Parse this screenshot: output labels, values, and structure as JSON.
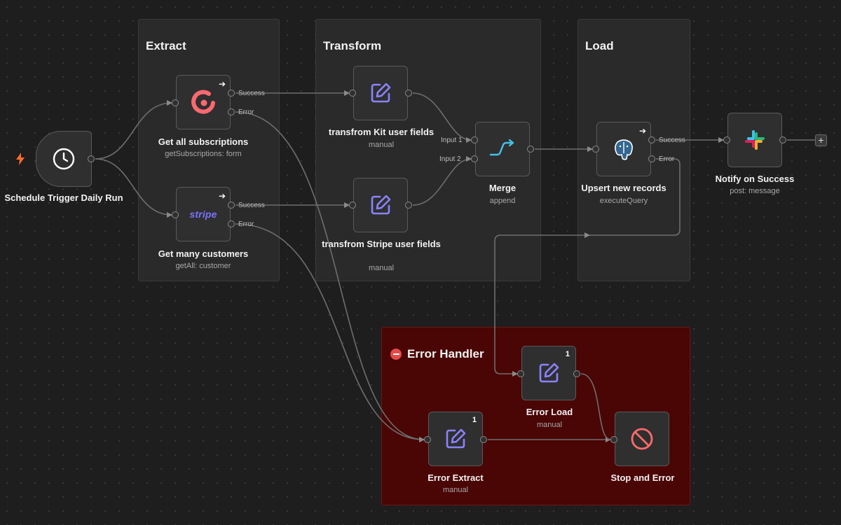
{
  "groups": {
    "extract": "Extract",
    "transform": "Transform",
    "load": "Load",
    "error_handler": "Error Handler"
  },
  "nodes": {
    "schedule": {
      "title": "Schedule Trigger Daily Run",
      "icon": "clock-icon"
    },
    "subscriptions": {
      "title": "Get all subscriptions",
      "subtitle": "getSubscriptions: form",
      "icon": "kit-logo-icon"
    },
    "customers": {
      "title": "Get many customers",
      "subtitle": "getAll: customer",
      "icon": "stripe-logo",
      "logo_text": "stripe"
    },
    "kit_transform": {
      "title": "transfrom Kit user fields",
      "subtitle": "manual",
      "icon": "edit-icon"
    },
    "stripe_transform": {
      "title": "transfrom Stripe user fields",
      "subtitle": "manual",
      "icon": "edit-icon"
    },
    "merge": {
      "title": "Merge",
      "subtitle": "append",
      "icon": "merge-icon"
    },
    "upsert": {
      "title": "Upsert new records",
      "subtitle": "executeQuery",
      "icon": "postgres-icon"
    },
    "notify": {
      "title": "Notify on Success",
      "subtitle": "post: message",
      "icon": "slack-icon"
    },
    "error_load": {
      "title": "Error Load",
      "subtitle": "manual",
      "badge": "1",
      "icon": "edit-icon"
    },
    "error_extract": {
      "title": "Error Extract",
      "subtitle": "manual",
      "badge": "1",
      "icon": "edit-icon"
    },
    "stop_error": {
      "title": "Stop and Error",
      "icon": "stop-icon"
    }
  },
  "ports": {
    "success": "Success",
    "error": "Error",
    "input1": "Input 1",
    "input2": "Input 2"
  },
  "add_button": "+",
  "colors": {
    "canvas": "#1e1e1e",
    "group": "#2a2a2a",
    "error_group": "#4a0505",
    "edit_icon": "#8b83ff",
    "merge_icon": "#45c3e8",
    "kit_logo": "#fb6970",
    "stop_icon": "#ff6b6b",
    "trigger_bolt": "#ff6d2e"
  }
}
